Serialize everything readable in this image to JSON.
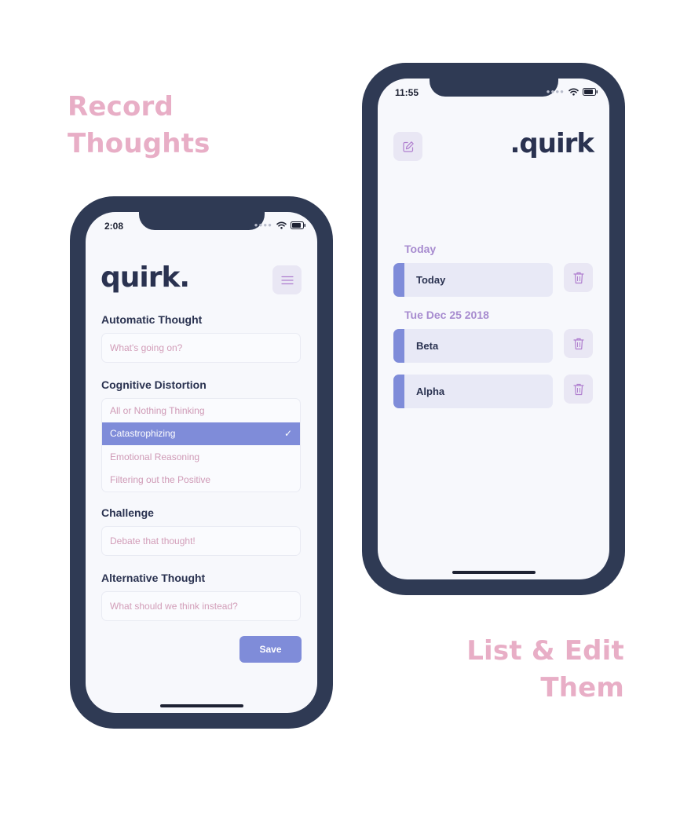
{
  "captions": {
    "left": [
      "Record",
      "Thoughts"
    ],
    "right": [
      "List & Edit",
      "Them"
    ]
  },
  "left_screen": {
    "status_time": "2:08",
    "logo": "quirk.",
    "menu_icon": "hamburger-menu-icon",
    "automatic_thought": {
      "label": "Automatic Thought",
      "placeholder": "What's going on?"
    },
    "cognitive_distortion": {
      "label": "Cognitive Distortion",
      "options": [
        {
          "label": "All or Nothing Thinking",
          "selected": false
        },
        {
          "label": "Catastrophizing",
          "selected": true
        },
        {
          "label": "Emotional Reasoning",
          "selected": false
        },
        {
          "label": "Filtering out the Positive",
          "selected": false
        }
      ],
      "check_glyph": "✓"
    },
    "challenge": {
      "label": "Challenge",
      "placeholder": "Debate that thought!"
    },
    "alternative_thought": {
      "label": "Alternative Thought",
      "placeholder": "What should we think instead?"
    },
    "save_label": "Save"
  },
  "right_screen": {
    "status_time": "11:55",
    "logo": ".quirk",
    "edit_icon": "pencil-square-icon",
    "sections": [
      {
        "date": "Today",
        "items": [
          "Today"
        ]
      },
      {
        "date": "Tue Dec 25 2018",
        "items": [
          "Beta",
          "Alpha"
        ]
      }
    ],
    "trash_icon": "trash-icon"
  },
  "colors": {
    "frame": "#2f3a54",
    "accent": "#7f8cd9",
    "caption": "#e8aec6",
    "placeholder": "#cf9ab6",
    "section_date": "#a78bcf"
  }
}
